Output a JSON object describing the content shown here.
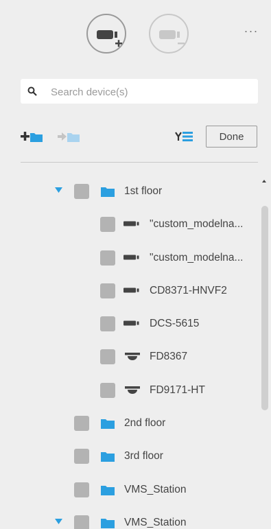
{
  "header": {
    "add_device_icon": "camera-add-icon",
    "remove_device_icon": "camera-remove-icon",
    "more_label": "···"
  },
  "search": {
    "placeholder": "Search device(s)"
  },
  "toolbar": {
    "add_folder_icon": "add-folder-icon",
    "move_folder_icon": "move-to-folder-icon",
    "collapse_icon": "collapse-list-icon",
    "done_label": "Done"
  },
  "tree": {
    "items": [
      {
        "label": "1st floor",
        "type": "folder",
        "expanded": true
      },
      {
        "label": "\"custom_modelna...",
        "type": "bullet-camera"
      },
      {
        "label": "\"custom_modelna...",
        "type": "bullet-camera"
      },
      {
        "label": "CD8371-HNVF2",
        "type": "bullet-camera"
      },
      {
        "label": "DCS-5615",
        "type": "bullet-camera"
      },
      {
        "label": "FD8367",
        "type": "dome-camera"
      },
      {
        "label": "FD9171-HT",
        "type": "dome-camera"
      },
      {
        "label": "2nd floor",
        "type": "folder"
      },
      {
        "label": "3rd floor",
        "type": "folder"
      },
      {
        "label": "VMS_Station",
        "type": "folder"
      },
      {
        "label": "VMS_Station",
        "type": "folder",
        "expanded": true
      }
    ]
  },
  "colors": {
    "accent": "#2b9fe0",
    "background": "#eeeeee",
    "checkbox": "#b3b3b3",
    "icon_dark": "#444444"
  }
}
